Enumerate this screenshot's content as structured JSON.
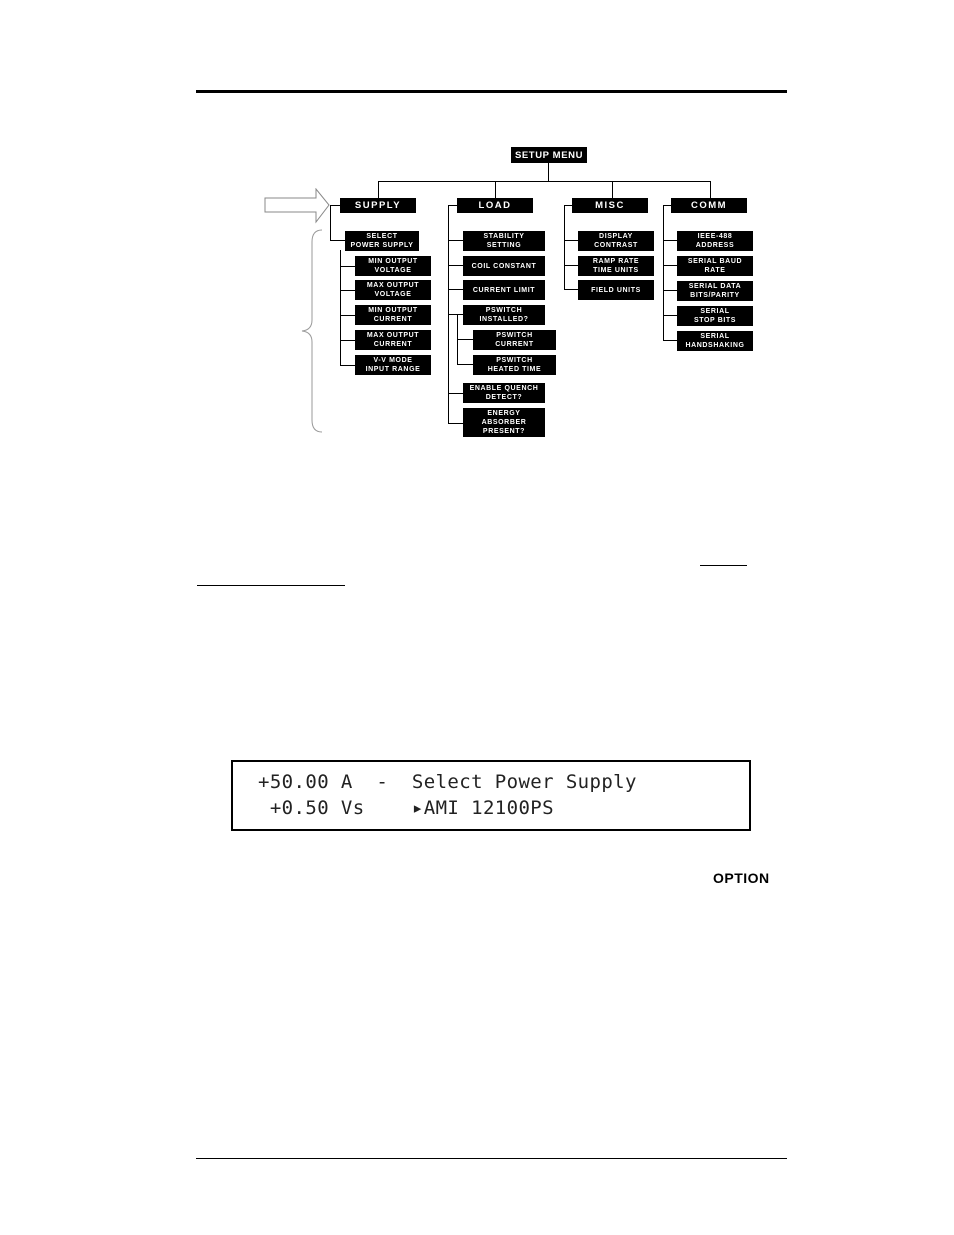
{
  "diagram": {
    "root": "SETUP MENU",
    "categories": [
      {
        "label": "SUPPLY",
        "items": [
          "SELECT\nPOWER SUPPLY",
          "MIN OUTPUT\nVOLTAGE",
          "MAX OUTPUT\nVOLTAGE",
          "MIN OUTPUT\nCURRENT",
          "MAX OUTPUT\nCURRENT",
          "V-V MODE\nINPUT RANGE"
        ]
      },
      {
        "label": "LOAD",
        "items": [
          "STABILITY\nSETTING",
          "COIL CONSTANT",
          "CURRENT LIMIT",
          "PSWITCH\nINSTALLED?",
          "PSWITCH\nCURRENT",
          "PSWITCH\nHEATED TIME",
          "ENABLE QUENCH\nDETECT?",
          "ENERGY\nABSORBER\nPRESENT?"
        ]
      },
      {
        "label": "MISC",
        "items": [
          "DISPLAY\nCONTRAST",
          "RAMP RATE\nTIME UNITS",
          "FIELD UNITS"
        ]
      },
      {
        "label": "COMM",
        "items": [
          "IEEE-488\nADDRESS",
          "SERIAL BAUD\nRATE",
          "SERIAL DATA\nBITS/PARITY",
          "SERIAL\nSTOP BITS",
          "SERIAL\nHANDSHAKING"
        ]
      }
    ],
    "pointer_arrow_icon": "outline-right-arrow",
    "brace_icon": "left-curly-brace"
  },
  "lcd": {
    "row1": "+50.00 A  -  Select Power Supply",
    "row2": " +0.50 Vs    ▸AMI 12100PS"
  },
  "option_label": "OPTION"
}
